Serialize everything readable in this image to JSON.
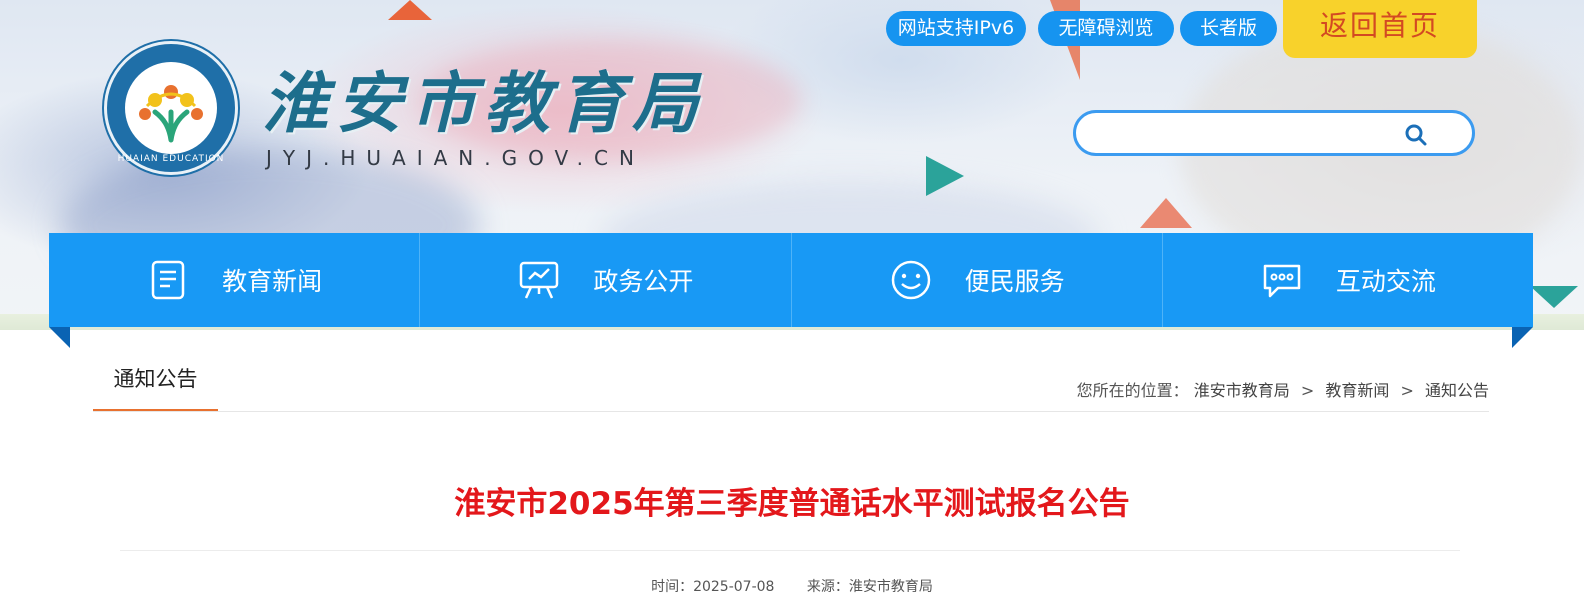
{
  "header": {
    "site_name": "淮安市教育局",
    "domain": "JYJ.HUAIAN.GOV.CN",
    "seal_text": "HUAIAN EDUCATION",
    "top_links": [
      {
        "label": "网站支持IPv6"
      },
      {
        "label": "无障碍浏览"
      },
      {
        "label": "长者版"
      }
    ],
    "home_button": "返回首页",
    "search": {
      "placeholder": "",
      "value": ""
    }
  },
  "nav": {
    "items": [
      {
        "label": "教育新闻",
        "icon": "document-icon"
      },
      {
        "label": "政务公开",
        "icon": "presentation-board-icon"
      },
      {
        "label": "便民服务",
        "icon": "smiley-icon"
      },
      {
        "label": "互动交流",
        "icon": "chat-bubble-icon"
      }
    ]
  },
  "section": {
    "tab_label": "通知公告",
    "breadcrumb": {
      "prefix": "您所在的位置：",
      "items": [
        "淮安市教育局",
        "教育新闻",
        "通知公告"
      ],
      "separator": ">"
    }
  },
  "article": {
    "title": "淮安市2025年第三季度普通话水平测试报名公告",
    "time_label": "时间：2025-07-08",
    "source_label": "来源：淮安市教育局"
  },
  "colors": {
    "nav_blue": "#1899f5",
    "pill_blue": "#1694f0",
    "home_yellow": "#f8d22b",
    "home_text": "#d34a22",
    "title_red": "#e3171b",
    "tab_underline": "#e8712f"
  }
}
